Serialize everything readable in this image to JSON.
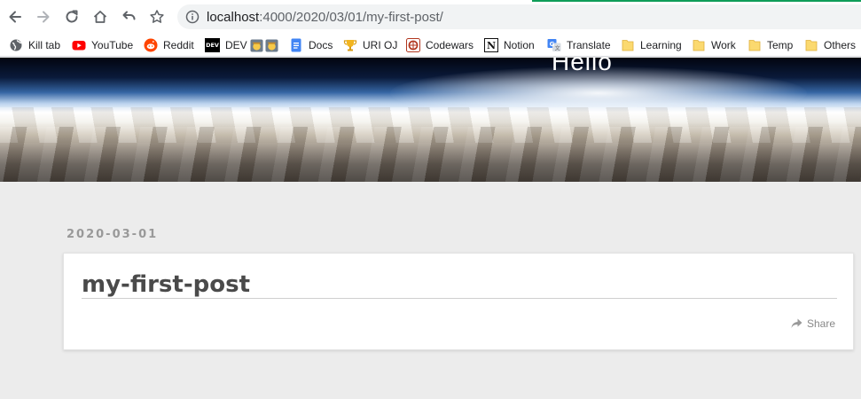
{
  "browser": {
    "url_host": "localhost",
    "url_path": ":4000/2020/03/01/my-first-post/",
    "accent_color": "#0f9d58"
  },
  "bookmarks": [
    {
      "label": "Kill tab",
      "icon": "globe-icon"
    },
    {
      "label": "YouTube",
      "icon": "youtube-icon"
    },
    {
      "label": "Reddit",
      "icon": "reddit-icon"
    },
    {
      "label": "DEV",
      "icon": "dev-icon"
    },
    {
      "label": "Docs",
      "icon": "docs-icon"
    },
    {
      "label": "URI OJ",
      "icon": "trophy-icon"
    },
    {
      "label": "Codewars",
      "icon": "codewars-icon"
    },
    {
      "label": "Notion",
      "icon": "notion-icon"
    },
    {
      "label": "Translate",
      "icon": "translate-icon"
    },
    {
      "label": "Learning",
      "icon": "folder-icon"
    },
    {
      "label": "Work",
      "icon": "folder-icon"
    },
    {
      "label": "Temp",
      "icon": "folder-icon"
    },
    {
      "label": "Others",
      "icon": "folder-icon"
    }
  ],
  "hero": {
    "title": "Hello"
  },
  "post": {
    "date": "2020-03-01",
    "title": "my-first-post",
    "share_label": "Share"
  }
}
